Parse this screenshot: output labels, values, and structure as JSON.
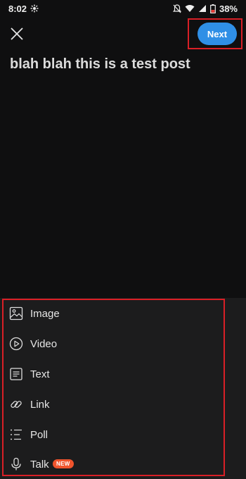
{
  "status_bar": {
    "time": "8:02",
    "battery": "38%"
  },
  "header": {
    "next_label": "Next"
  },
  "post": {
    "title": "blah blah this is a test post"
  },
  "attachments": [
    {
      "label": "Image",
      "icon": "image-icon"
    },
    {
      "label": "Video",
      "icon": "play-icon"
    },
    {
      "label": "Text",
      "icon": "text-icon"
    },
    {
      "label": "Link",
      "icon": "link-icon"
    },
    {
      "label": "Poll",
      "icon": "poll-icon"
    },
    {
      "label": "Talk",
      "icon": "microphone-icon",
      "badge": "NEW"
    }
  ],
  "colors": {
    "accent": "#2f8fe6",
    "highlight_outline": "#d91f26",
    "badge": "#f0542d",
    "background": "#0f0f10",
    "sheet": "#1c1c1d"
  }
}
